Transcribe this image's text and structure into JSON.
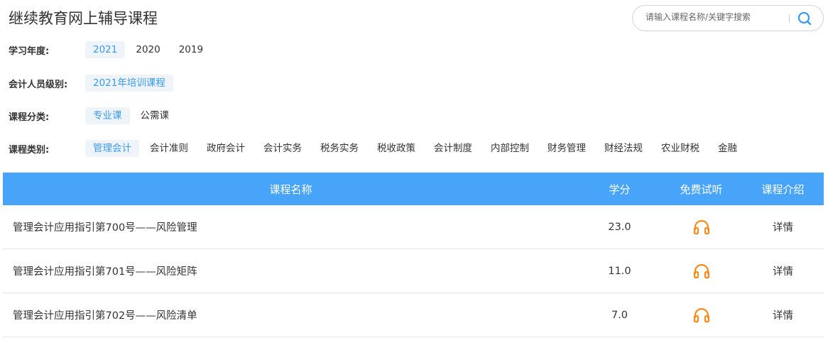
{
  "header": {
    "title": "继续教育网上辅导课程",
    "search_placeholder": "请输入课程名称/关键字搜索"
  },
  "filters": [
    {
      "label": "学习年度:",
      "options": [
        "2021",
        "2020",
        "2019"
      ],
      "active": 0
    },
    {
      "label": "会计人员级别:",
      "options": [
        "2021年培训课程"
      ],
      "active": 0
    },
    {
      "label": "课程分类:",
      "options": [
        "专业课",
        "公需课"
      ],
      "active": 0
    },
    {
      "label": "课程类别:",
      "options": [
        "管理会计",
        "会计准则",
        "政府会计",
        "会计实务",
        "税务实务",
        "税收政策",
        "会计制度",
        "内部控制",
        "财务管理",
        "财经法规",
        "农业财税",
        "金融"
      ],
      "active": 0
    }
  ],
  "table": {
    "headers": [
      "课程名称",
      "学分",
      "免费试听",
      "课程介绍"
    ],
    "rows": [
      {
        "name": "管理会计应用指引第700号——风险管理",
        "credit": "23.0",
        "detail": "详情"
      },
      {
        "name": "管理会计应用指引第701号——风险矩阵",
        "credit": "11.0",
        "detail": "详情"
      },
      {
        "name": "管理会计应用指引第702号——风险清单",
        "credit": "7.0",
        "detail": "详情"
      }
    ]
  },
  "colors": {
    "accent": "#48a4f9",
    "icon": "#f98a1c"
  }
}
